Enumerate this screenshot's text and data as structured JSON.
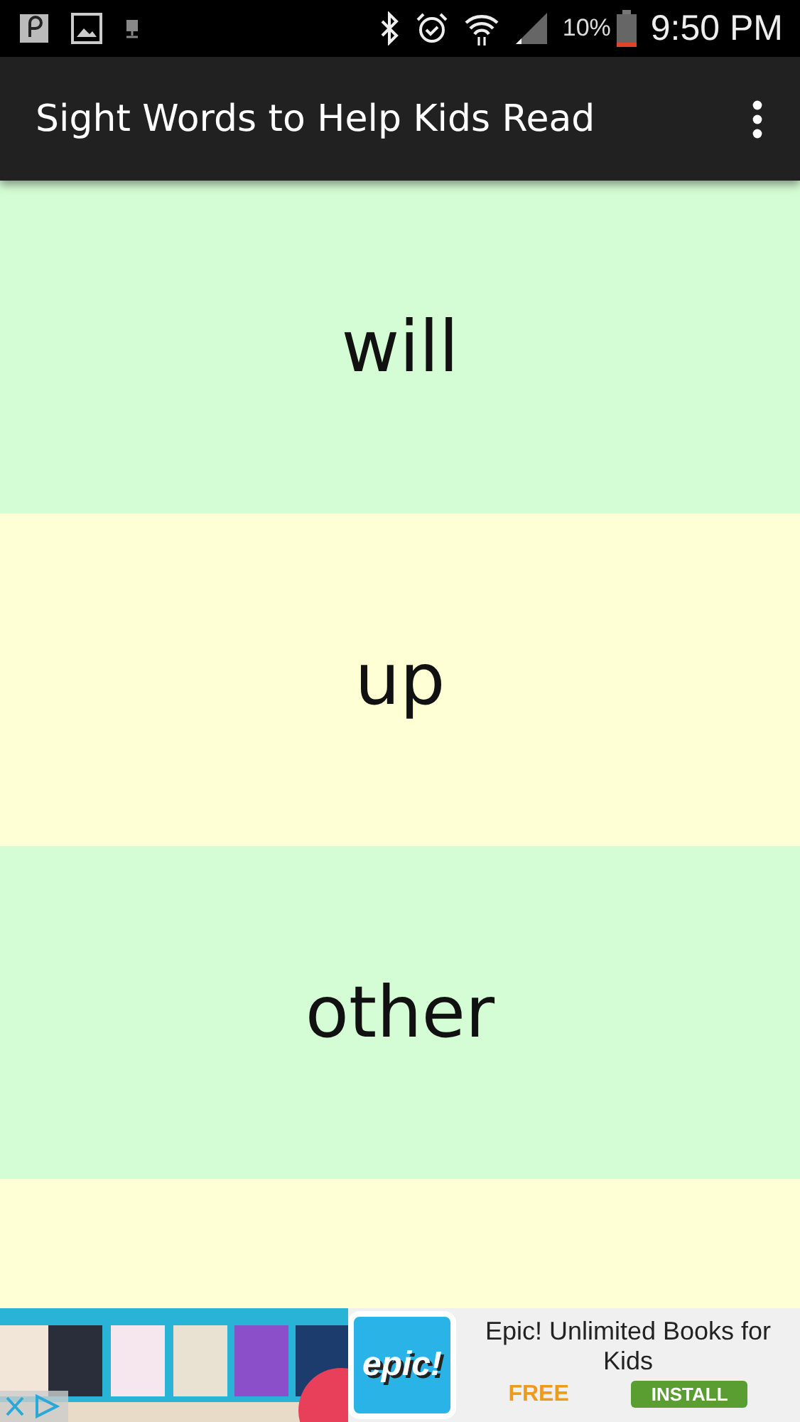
{
  "status_bar": {
    "battery": "10%",
    "time": "9:50 PM"
  },
  "app_bar": {
    "title": "Sight Words to Help Kids Read"
  },
  "words": [
    {
      "word": "will",
      "color": "#d5fdd5"
    },
    {
      "word": "up",
      "color": "#ffffd5"
    },
    {
      "word": "other",
      "color": "#d5fdd5"
    },
    {
      "color": "#ffffd5"
    }
  ],
  "ad": {
    "logo": "epic!",
    "title": "Epic! Unlimited Books for Kids",
    "price": "FREE",
    "button": "INSTALL"
  }
}
